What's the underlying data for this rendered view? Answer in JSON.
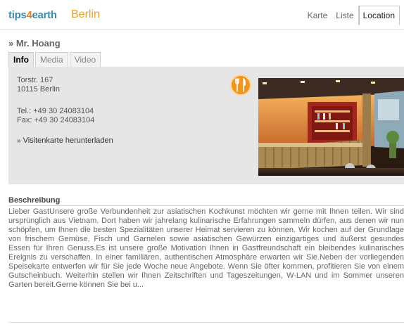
{
  "header": {
    "logo_a": "tips",
    "logo_b": "4",
    "logo_c": "earth",
    "city": "Berlin",
    "nav": [
      "Karte",
      "Liste",
      "Location"
    ]
  },
  "place": {
    "title": "» Mr. Hoang",
    "tabs": [
      "Info",
      "Media",
      "Video"
    ],
    "address_line1": "Torstr. 167",
    "address_line2": "10115 Berlin",
    "tel": "Tel.: +49 30 24083104",
    "fax": "Fax: +49 30 24083104",
    "vcard_arrow": "»",
    "vcard_label": "Visitenkarte herunterladen",
    "category_icon": "restaurant-icon"
  },
  "description": {
    "heading": "Beschreibung",
    "text": "Lieber GastUnsere große Verbundenheit zur asiatischen Kochkunst möchten wir gerne mit Ihnen teilen. Wir sind ursprünglich aus Vietnam. Dort haben wir jahrelang kulinarische Erfahrungen sammeln dürfen, aus denen wir nun schöpfen, um Ihnen die besten Spezialitäten unserer Heimat servieren zu können. Wir kochen auf der Grundlage von frischem Gemüse, Fisch und Garnelen sowie asiatischen Gewürzen einzigartiges und äußerst gesundes Essen für Ihren Genuss.Es ist unsere große Motivation Ihnen in Gastfreundschaft ein bleibendes kulinarisches Ereignis zu verschaffen. In einer familiären, authentischen Atmosphäre erwarten wir Sie.Neben der vorliegenden Speisekarte entwerfen wir für Sie jede Woche neue Angebote. Wenn Sie öfter kommen, profitieren Sie von einem Gutscheinbuch. Weiterhin stellen wir Ihnen Zeitschriften und Tageszeitungen, W-LAN und im Sommer unseren Garten bereit.Gerne können Sie bei u..."
  },
  "colors": {
    "accent_orange": "#f0961e",
    "logo_blue": "#3b8ab0",
    "panel_bg": "#e6e6e6"
  }
}
